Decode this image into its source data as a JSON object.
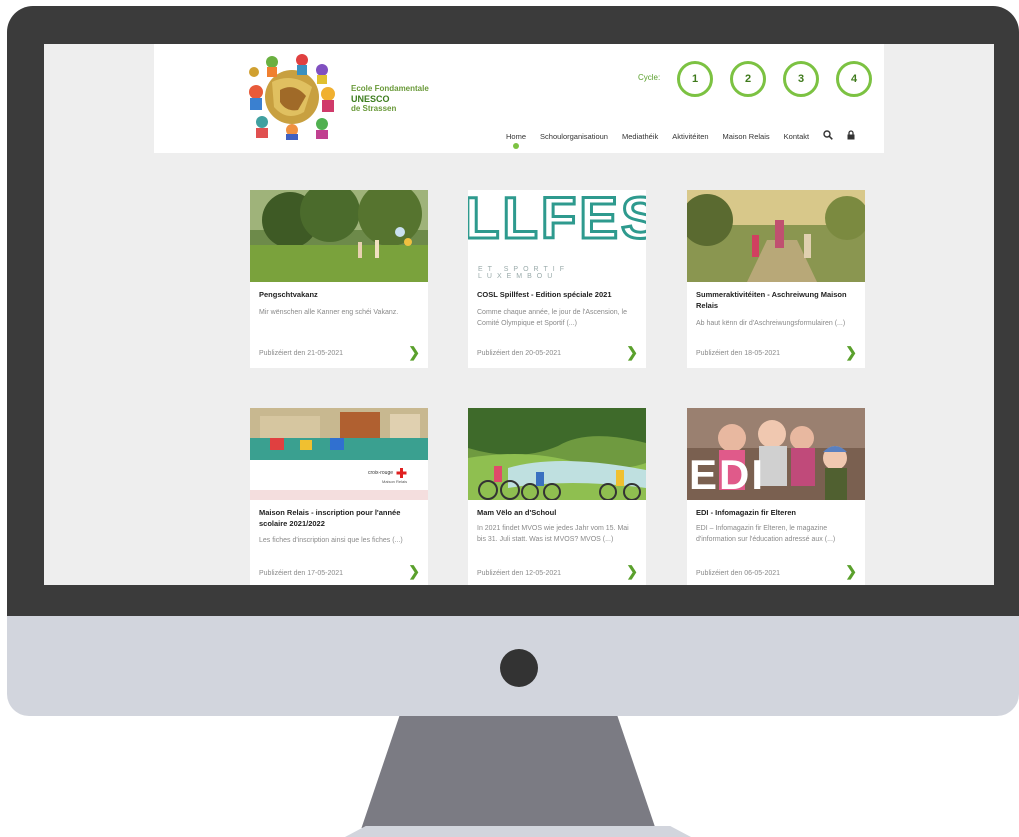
{
  "school": {
    "name_line1": "Ecole Fondamentale",
    "name_line2": "UNESCO",
    "name_line3": "de Strassen"
  },
  "cycles": {
    "label": "Cycle:",
    "items": [
      "1",
      "2",
      "3",
      "4"
    ]
  },
  "nav": {
    "items": [
      "Home",
      "Schoulorganisatioun",
      "Mediathéik",
      "Aktivitéiten",
      "Maison Relais",
      "Kontakt"
    ],
    "active_index": 0,
    "search_icon": "search-icon",
    "lock_icon": "lock-icon"
  },
  "cards": [
    {
      "title": "Pengschtvakanz",
      "excerpt": "Mir wënschen alle Kanner eng schéi Vakanz.",
      "published": "Publizéiert den 21-05-2021"
    },
    {
      "title": "COSL Spillfest - Edition spéciale 2021",
      "excerpt": "Comme chaque année, le jour de l'Ascension, le Comité Olympique et Sportif (...)",
      "published": "Publizéiert den 20-05-2021",
      "image_text_main": "LLFES",
      "image_text_sub": "ET SPORTIF LUXEMBOU"
    },
    {
      "title": "Summeraktivitéiten - Aschreiwung Maison Relais",
      "excerpt": "Ab haut kënn dir d'Aschreiwungsformulairen (...)",
      "published": "Publizéiert den 18-05-2021"
    },
    {
      "title": "Maison Relais - inscription pour l'année scolaire 2021/2022",
      "excerpt": "Les fiches d'inscription ainsi que les fiches (...)",
      "published": "Publizéiert den 17-05-2021",
      "image_text_main": "croix-rouge",
      "image_text_sub": "Maison Relais"
    },
    {
      "title": "Mam Vëlo an d'Schoul",
      "excerpt": "In 2021 findet MVOS wie jedes Jahr vom 15. Mai bis 31. Juli statt. Was ist MVOS? MVOS (...)",
      "published": "Publizéiert den 12-05-2021"
    },
    {
      "title": "EDI - Infomagazin fir Elteren",
      "excerpt": "EDI – Infomagazin fir Elteren, le magazine d'information sur l'éducation adressé aux (...)",
      "published": "Publizéiert den 06-05-2021",
      "image_text_main": "EDI"
    }
  ],
  "colors": {
    "accent": "#7cc242",
    "accent_dark": "#3f7a1c",
    "monitor_bezel": "#3b3b3b",
    "monitor_chin": "#d2d5dd",
    "screen_bg": "#eeeeee"
  }
}
